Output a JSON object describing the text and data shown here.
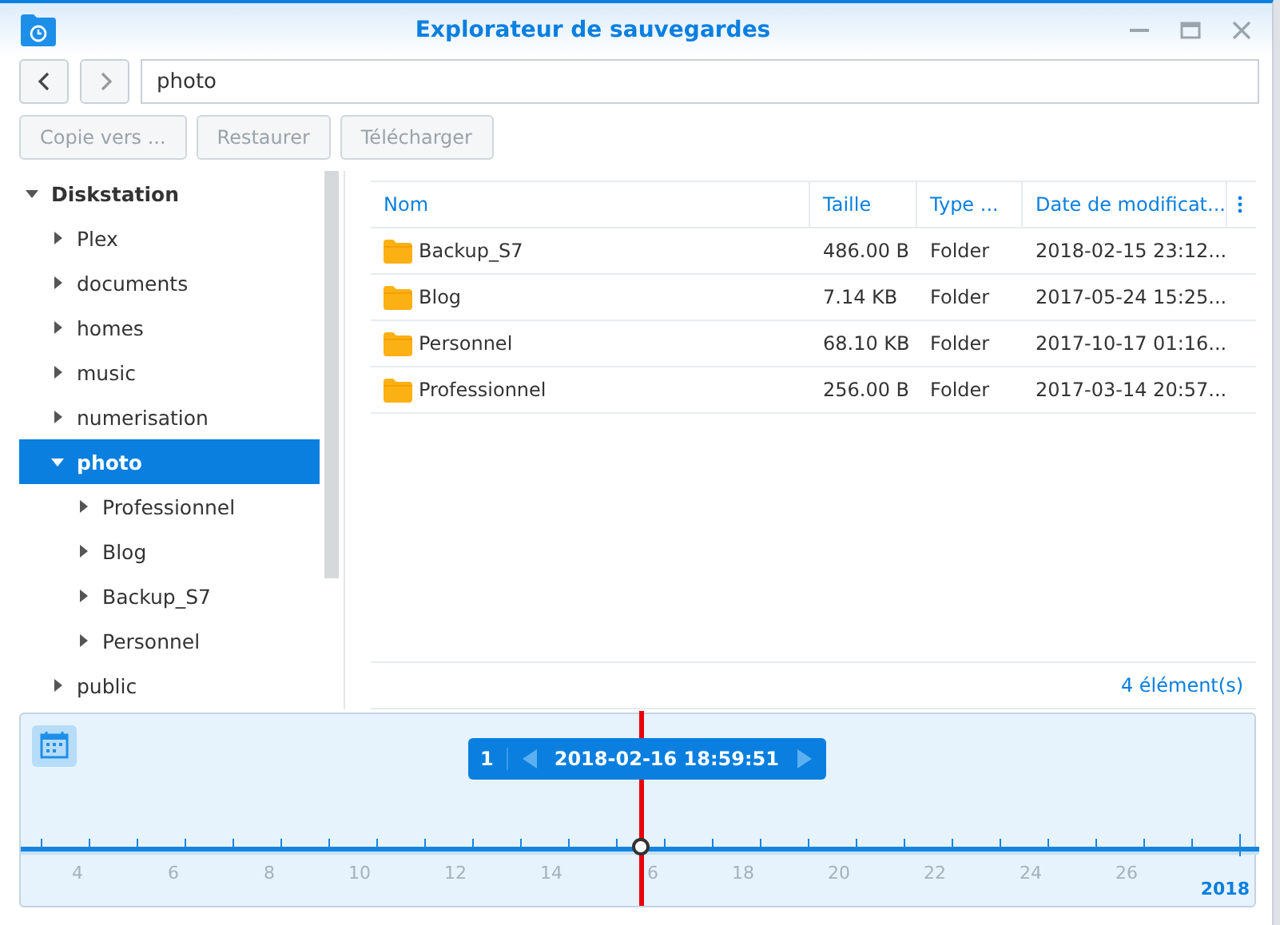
{
  "window": {
    "title": "Explorateur de sauvegardes"
  },
  "path": {
    "value": "photo"
  },
  "actions": [
    {
      "label": "Copie vers ...",
      "disabled": true
    },
    {
      "label": "Restaurer",
      "disabled": true
    },
    {
      "label": "Télécharger",
      "disabled": true
    }
  ],
  "tree": [
    {
      "label": "Diskstation",
      "expanded": true,
      "selected": false,
      "children": [
        {
          "label": "Plex",
          "expanded": false,
          "selected": false
        },
        {
          "label": "documents",
          "expanded": false,
          "selected": false
        },
        {
          "label": "homes",
          "expanded": false,
          "selected": false
        },
        {
          "label": "music",
          "expanded": false,
          "selected": false
        },
        {
          "label": "numerisation",
          "expanded": false,
          "selected": false
        },
        {
          "label": "photo",
          "expanded": true,
          "selected": true,
          "children": [
            {
              "label": "Professionnel",
              "expanded": false,
              "selected": false
            },
            {
              "label": "Blog",
              "expanded": false,
              "selected": false
            },
            {
              "label": "Backup_S7",
              "expanded": false,
              "selected": false
            },
            {
              "label": "Personnel",
              "expanded": false,
              "selected": false
            }
          ]
        },
        {
          "label": "public",
          "expanded": false,
          "selected": false
        }
      ]
    }
  ],
  "table": {
    "columns": [
      "Nom",
      "Taille",
      "Type ...",
      "Date de modificat..."
    ],
    "rows": [
      {
        "name": "Backup_S7",
        "size": "486.00 B",
        "type": "Folder",
        "date": "2018-02-15 23:12..."
      },
      {
        "name": "Blog",
        "size": "7.14 KB",
        "type": "Folder",
        "date": "2017-05-24 15:25..."
      },
      {
        "name": "Personnel",
        "size": "68.10 KB",
        "type": "Folder",
        "date": "2017-10-17 01:16..."
      },
      {
        "name": "Professionnel",
        "size": "256.00 B",
        "type": "Folder",
        "date": "2017-03-14 20:57..."
      }
    ],
    "count": "4 élément(s)"
  },
  "timeline": {
    "version": "1",
    "datetime": "2018-02-16 18:59:51",
    "level": 0.5,
    "days": [
      "4",
      "6",
      "8",
      "10",
      "12",
      "14",
      "6",
      "18",
      "20",
      "22",
      "24",
      "26"
    ],
    "year": "2018"
  }
}
